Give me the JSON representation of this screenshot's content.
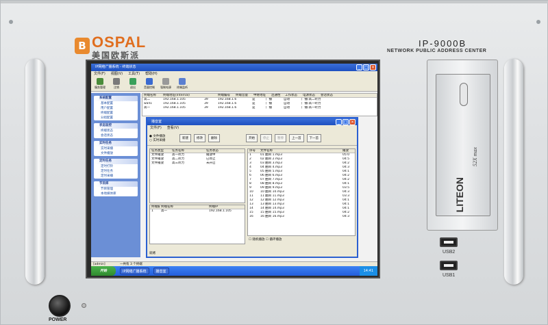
{
  "device": {
    "brand_en": "OSPAL",
    "brand_cn": "美国欧斯派",
    "model": "IP-9000B",
    "subtitle": "NETWORK PUBLIC ADDRESS CENTER",
    "power_label": "POWER",
    "usb1": "USB2",
    "usb2": "USB1",
    "drive_brand": "LITEON",
    "drive_speed": "52X max"
  },
  "app": {
    "window_title": "IP网络广播系统 - 终端状态",
    "menu": [
      "文件(F)",
      "视图(V)",
      "工具(T)",
      "帮助(H)"
    ],
    "toolbar": [
      "服务管理",
      "注销",
      "退出",
      "音量控制",
      "强制电源",
      "终端监听"
    ],
    "sidebar": [
      {
        "title": "系统配置",
        "items": [
          "基本配置",
          "用户配置",
          "终端配置",
          "分组配置"
        ]
      },
      {
        "title": "状态监控",
        "items": [
          "终端状态",
          "会话状态"
        ]
      },
      {
        "title": "实时任务",
        "items": [
          "实时采播",
          "文件播放"
        ]
      },
      {
        "title": "定时任务",
        "items": [
          "定时打铃",
          "定时任务",
          "定时采播"
        ]
      },
      {
        "title": "节目库",
        "items": [
          "节目管理",
          "本地媒体库"
        ]
      }
    ],
    "grid_headers": [
      "终端名称",
      "终端地址(Internal)",
      "终端编号",
      "终端音量",
      "中继地址",
      "连通性",
      "工作状态",
      "电源状态",
      "会话状态"
    ],
    "grid_rows": [
      [
        "高二",
        "192.168.1.105",
        "39",
        "192.168.1.6",
        "是",
        "广播",
        "自动",
        "广播:高二听力"
      ],
      [
        "wall1",
        "192.168.1.105",
        "39",
        "192.168.1.6",
        "是",
        "广播",
        "自动",
        "广播:高一听力"
      ],
      [
        "高一",
        "192.168.1.105",
        "39",
        "192.168.1.6",
        "是",
        "广播",
        "自动",
        "广播:高一听力"
      ]
    ],
    "status_left": "[admin]",
    "status_mid": "一共有 3 个终端",
    "taskbar": {
      "start": "开始",
      "tasks": [
        "IP网络广播系统",
        "播音室"
      ],
      "clock": "14:41"
    }
  },
  "dialog": {
    "title": "播音室",
    "menu": [
      "文件(F)",
      "查看(V)"
    ],
    "radio1": "文件播放",
    "radio2": "实时采播",
    "buttons": [
      "新建",
      "修改",
      "删除"
    ],
    "play_buttons": [
      "开始",
      "停止",
      "暂停",
      "上一首",
      "下一首"
    ],
    "task_headers": [
      "任务类型",
      "任务名称",
      "任务状态"
    ],
    "tasks": [
      [
        "文件播放",
        "高一听力",
        "播放中"
      ],
      [
        "文件播放",
        "高二听力",
        "已停止"
      ],
      [
        "文件播放",
        "高三听力",
        "未开启"
      ]
    ],
    "term_headers": [
      "终端编号",
      "终端名称",
      "终端IP"
    ],
    "terms": [
      [
        "1",
        "高一",
        "192.168.1.105"
      ]
    ],
    "file_headers": [
      "序号",
      "文件名称",
      "播放"
    ],
    "files": [
      [
        "1",
        "01 曲目 1.mp3",
        "05:0"
      ],
      [
        "2",
        "02 曲目 2.mp3",
        "04:5"
      ],
      [
        "3",
        "03 曲目 3.mp3",
        "04:2"
      ],
      [
        "4",
        "04 曲目 4.mp3",
        "04:3"
      ],
      [
        "5",
        "05 曲目 5.mp3",
        "04:1"
      ],
      [
        "6",
        "06 曲目 6.mp3",
        "04:2"
      ],
      [
        "7",
        "07 曲目 7.mp3",
        "04:2"
      ],
      [
        "8",
        "08 曲目 8.mp3",
        "04:1"
      ],
      [
        "9",
        "09 曲目 9.mp3",
        "03:5"
      ],
      [
        "10",
        "10 曲目 10.mp3",
        "04:3"
      ],
      [
        "11",
        "11 曲目 11.mp3",
        "03:3"
      ],
      [
        "12",
        "12 曲目 12.mp3",
        "04:1"
      ],
      [
        "13",
        "13 曲目 13.mp3",
        "04:1"
      ],
      [
        "14",
        "14 曲目 14.mp3",
        "04:1"
      ],
      [
        "15",
        "15 曲目 15.mp3",
        "04:2"
      ],
      [
        "16",
        "16 曲目 16.mp3",
        "04:3"
      ]
    ],
    "chk1": "随机播放",
    "chk2": "循环播放",
    "status": "就绪"
  }
}
